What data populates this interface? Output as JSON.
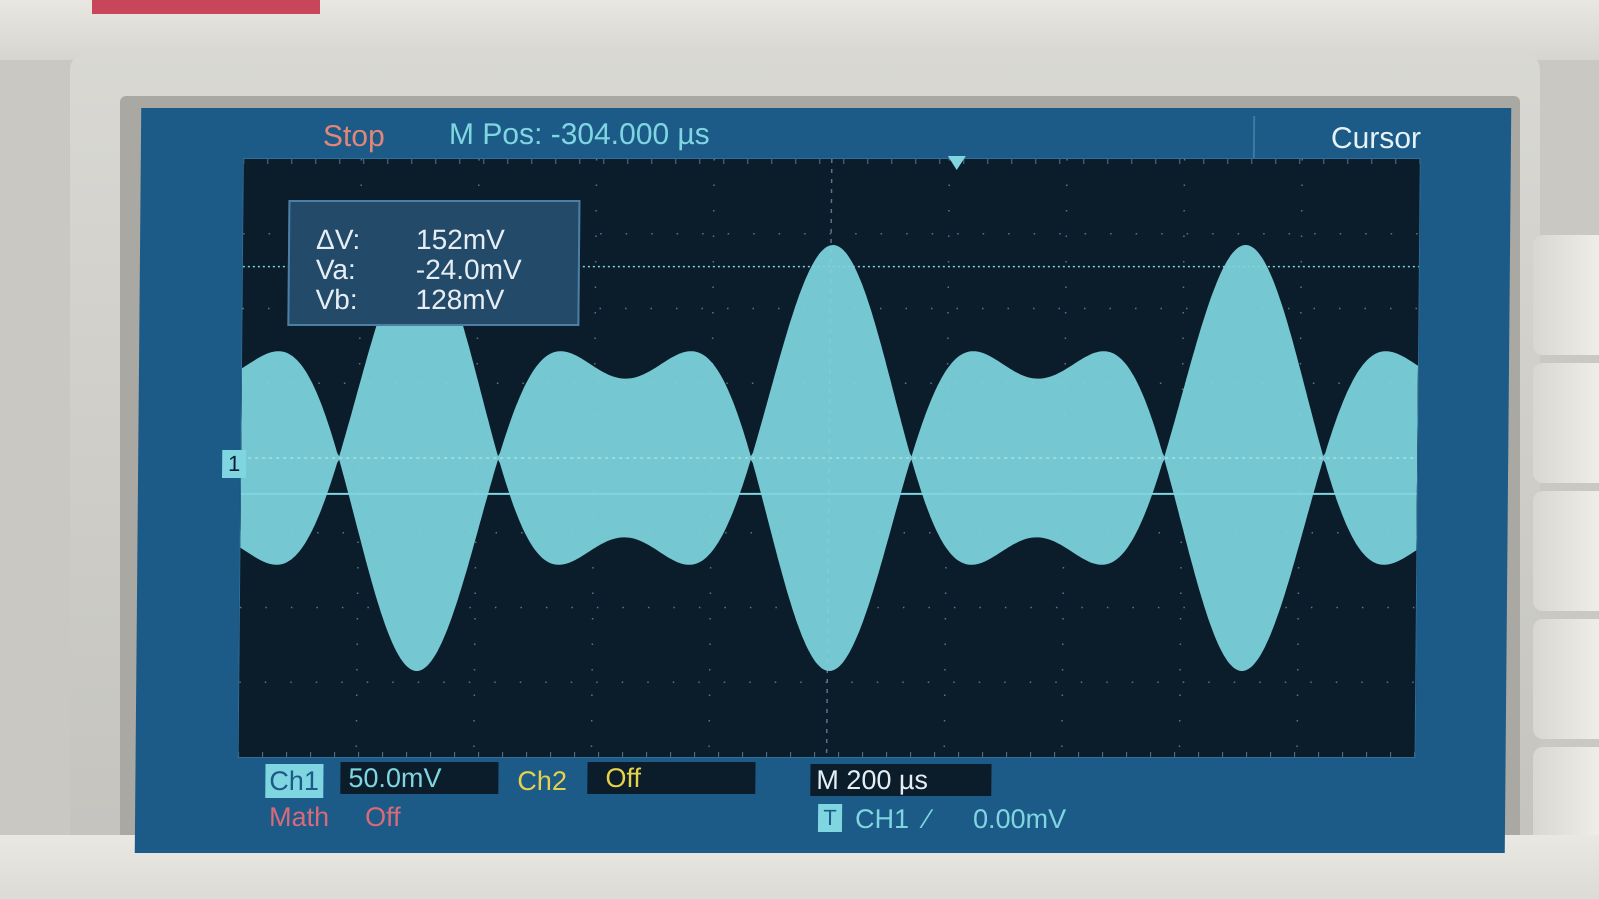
{
  "status": "Stop",
  "horizontal_position": "M Pos: -304.000 µs",
  "menu_title": "Cursor",
  "cursor_readout": [
    {
      "label": "ΔV:",
      "value": "152mV"
    },
    {
      "label": "Va:",
      "value": "-24.0mV"
    },
    {
      "label": "Vb:",
      "value": "128mV"
    }
  ],
  "channel_marker": "1",
  "channels": {
    "ch1": {
      "label": "Ch1",
      "scale": "50.0mV"
    },
    "ch2": {
      "label": "Ch2",
      "value": "Off"
    },
    "math": {
      "label": "Math",
      "value": "Off"
    }
  },
  "timebase": "M 200 µs",
  "trigger": {
    "icon": "T",
    "source": "CH1",
    "slope_glyph": "∕",
    "level": "0.00mV"
  },
  "colors": {
    "trace": "#7fd6e0",
    "screen_bg": "#0b1d2b",
    "panel_bg": "#1c5a88",
    "status": "#e2867a",
    "ch2": "#e6d24a",
    "math": "#d86a7a"
  }
}
